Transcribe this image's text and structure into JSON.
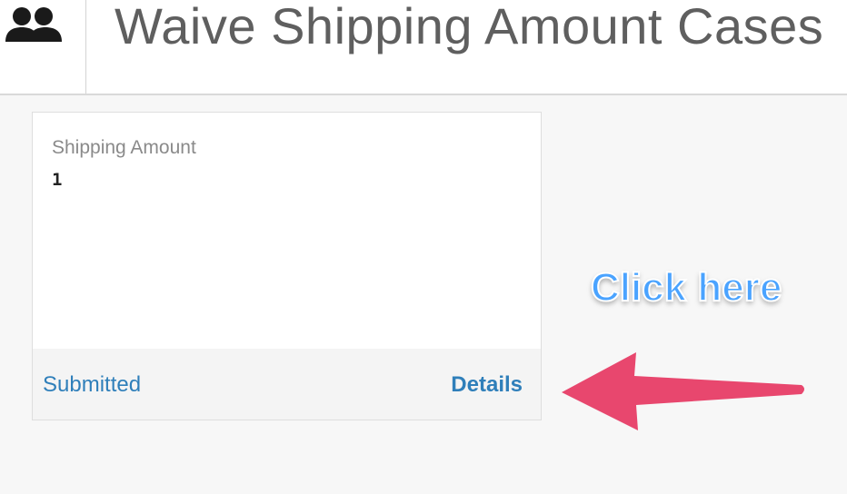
{
  "header": {
    "icon": "people-icon",
    "title": "Waive Shipping Amount Cases"
  },
  "card": {
    "field_label": "Shipping Amount",
    "field_value": "1",
    "status": "Submitted",
    "details_label": "Details"
  },
  "annotation": {
    "callout_text": "Click here",
    "callout_color": "#4aa3ff",
    "arrow_color": "#e8476e",
    "arrow_icon": "arrow-left-icon"
  }
}
